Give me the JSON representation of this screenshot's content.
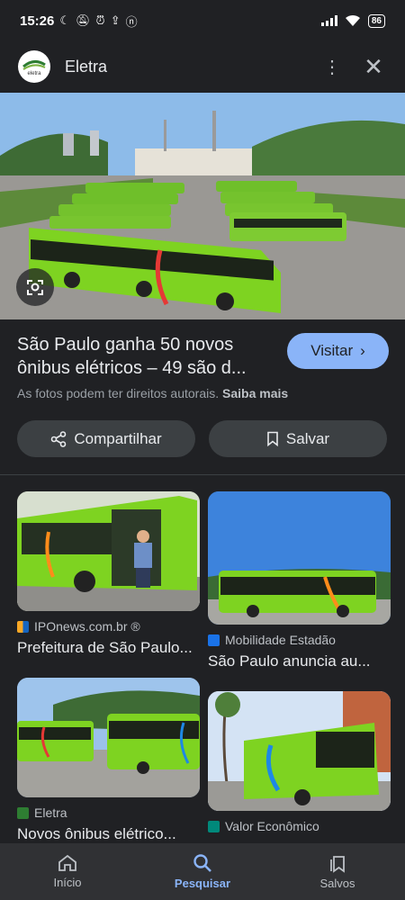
{
  "status_bar": {
    "time": "15:26",
    "battery": "86"
  },
  "app_bar": {
    "title": "Eletra",
    "logo_text": "eletra"
  },
  "result": {
    "title": "São Paulo ganha 50 novos ônibus elétricos – 49 são d...",
    "visit_label": "Visitar",
    "rights_text": "As fotos podem ter direitos autorais.",
    "rights_link": "Saiba mais",
    "share_label": "Compartilhar",
    "save_label": "Salvar"
  },
  "related": [
    {
      "source": "IPOnews.com.br ®",
      "title": "Prefeitura de São Paulo..."
    },
    {
      "source": "Mobilidade Estadão",
      "title": "São Paulo anuncia au..."
    },
    {
      "source": "Eletra",
      "title": "Novos ônibus elétrico..."
    },
    {
      "source": "Valor Econômico",
      "title": ""
    }
  ],
  "bottom_nav": {
    "home": "Início",
    "search": "Pesquisar",
    "saved": "Salvos"
  },
  "colors": {
    "accent": "#8ab4f8",
    "background": "#202124",
    "bus_green": "#7ed321"
  }
}
